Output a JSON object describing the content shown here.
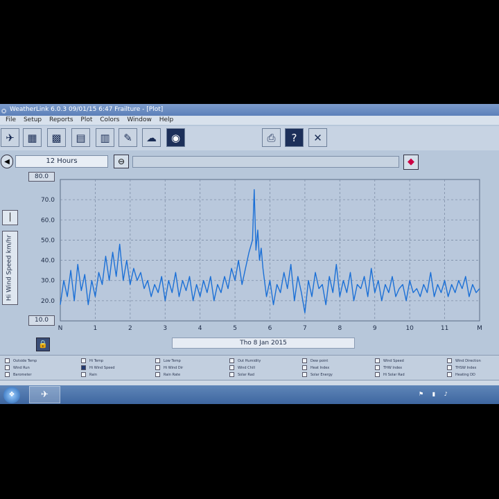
{
  "window": {
    "title": "WeatherLink 6.0.3  09/01/15  6:47 Frailture - [Plot]",
    "icon": "app-logo-icon"
  },
  "menu": [
    "File",
    "Setup",
    "Reports",
    "Plot",
    "Colors",
    "Window",
    "Help"
  ],
  "toolbar": {
    "left_icons": [
      "weatherlink-logo-icon",
      "station-icon",
      "summary-icon",
      "strip-chart-icon",
      "report-icon",
      "notes-icon",
      "cloud-icon",
      "noaa-icon"
    ],
    "right_icons": [
      "print-icon",
      "help-icon",
      "close-icon"
    ],
    "help_glyph": "?",
    "close_glyph": "✕"
  },
  "range": {
    "label": "12 Hours"
  },
  "chart": {
    "ymax_label": "80.0",
    "ymin_label": "10.0",
    "ylabel": "Hi Wind Speed  km/hr",
    "date": "Tho 8 Jan 2015"
  },
  "chart_data": {
    "type": "line",
    "xlabel": "",
    "ylabel": "Hi Wind Speed  km/hr",
    "x_ticks": [
      "N",
      "1",
      "2",
      "3",
      "4",
      "5",
      "6",
      "7",
      "8",
      "9",
      "10",
      "11",
      "M"
    ],
    "y_ticks": [
      "80.0",
      "70.0",
      "60.0",
      "50.0",
      "40.0",
      "30.0",
      "20.0",
      "10.0"
    ],
    "ylim": [
      10,
      80
    ],
    "xlim": [
      0,
      12
    ],
    "grid": true,
    "color": "#1a6fd6",
    "series": [
      {
        "x": [
          0,
          0.1,
          0.2,
          0.3,
          0.4,
          0.5,
          0.6,
          0.7,
          0.8,
          0.9,
          1.0,
          1.1,
          1.2,
          1.3,
          1.4,
          1.5,
          1.6,
          1.7,
          1.8,
          1.9,
          2.0,
          2.1,
          2.2,
          2.3,
          2.4,
          2.5,
          2.6,
          2.7,
          2.8,
          2.9,
          3.0,
          3.1,
          3.2,
          3.3,
          3.4,
          3.5,
          3.6,
          3.7,
          3.8,
          3.9,
          4.0,
          4.1,
          4.2,
          4.3,
          4.4,
          4.5,
          4.6,
          4.7,
          4.8,
          4.9,
          5.0,
          5.1,
          5.2,
          5.3,
          5.4,
          5.5,
          5.55,
          5.6,
          5.65,
          5.7,
          5.75,
          5.8,
          5.9,
          6.0,
          6.1,
          6.2,
          6.3,
          6.4,
          6.5,
          6.6,
          6.7,
          6.8,
          6.9,
          7.0,
          7.1,
          7.2,
          7.3,
          7.4,
          7.5,
          7.6,
          7.7,
          7.8,
          7.9,
          8.0,
          8.1,
          8.2,
          8.3,
          8.4,
          8.5,
          8.6,
          8.7,
          8.8,
          8.9,
          9.0,
          9.1,
          9.2,
          9.3,
          9.4,
          9.5,
          9.6,
          9.7,
          9.8,
          9.9,
          10.0,
          10.1,
          10.2,
          10.3,
          10.4,
          10.5,
          10.6,
          10.7,
          10.8,
          10.9,
          11.0,
          11.1,
          11.2,
          11.3,
          11.4,
          11.5,
          11.6,
          11.7,
          11.8,
          11.9,
          12.0
        ],
        "y": [
          18,
          30,
          22,
          35,
          20,
          38,
          25,
          33,
          18,
          30,
          22,
          34,
          28,
          42,
          30,
          44,
          32,
          48,
          30,
          40,
          28,
          36,
          30,
          34,
          26,
          30,
          22,
          28,
          24,
          32,
          20,
          30,
          24,
          34,
          22,
          30,
          25,
          32,
          20,
          28,
          22,
          30,
          24,
          32,
          20,
          28,
          24,
          32,
          26,
          36,
          30,
          40,
          28,
          36,
          44,
          50,
          75,
          45,
          55,
          40,
          46,
          36,
          22,
          30,
          18,
          28,
          24,
          34,
          26,
          38,
          20,
          32,
          24,
          14,
          30,
          22,
          34,
          26,
          28,
          18,
          32,
          24,
          38,
          22,
          30,
          24,
          34,
          20,
          28,
          26,
          32,
          22,
          36,
          24,
          30,
          20,
          28,
          24,
          32,
          22,
          26,
          28,
          20,
          30,
          24,
          26,
          22,
          28,
          24,
          34,
          22,
          28,
          24,
          30,
          22,
          28,
          24,
          30,
          26,
          32,
          22,
          28,
          24,
          26
        ]
      }
    ]
  },
  "legend_items": [
    {
      "label": "Outside Temp",
      "checked": false
    },
    {
      "label": "Hi Temp",
      "checked": false
    },
    {
      "label": "Low Temp",
      "checked": false
    },
    {
      "label": "Out Humidity",
      "checked": false
    },
    {
      "label": "Dew point",
      "checked": false
    },
    {
      "label": "Wind Speed",
      "checked": false
    },
    {
      "label": "Wind Direction",
      "checked": false
    },
    {
      "label": "Wind Run",
      "checked": false
    },
    {
      "label": "Hi Wind Speed",
      "checked": true
    },
    {
      "label": "Hi Wind Dir",
      "checked": false
    },
    {
      "label": "Wind Chill",
      "checked": false
    },
    {
      "label": "Heat Index",
      "checked": false
    },
    {
      "label": "THW Index",
      "checked": false
    },
    {
      "label": "THSW Index",
      "checked": false
    },
    {
      "label": "Barometer",
      "checked": false
    },
    {
      "label": "Rain",
      "checked": false
    },
    {
      "label": "Rain Rate",
      "checked": false
    },
    {
      "label": "Solar Rad",
      "checked": false
    },
    {
      "label": "Solar Energy",
      "checked": false
    },
    {
      "label": "Hi Solar Rad",
      "checked": false
    },
    {
      "label": "Heating DD",
      "checked": false
    }
  ],
  "taskbar": {
    "start": "start-orb-icon",
    "app": "weatherlink-task-icon",
    "tray_icons": [
      "flag-icon",
      "network-icon",
      "volume-icon"
    ]
  }
}
